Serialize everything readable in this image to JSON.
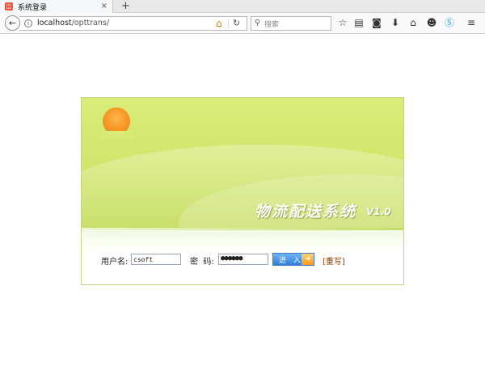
{
  "browser": {
    "tab_title": "系统登录",
    "tab_close": "×",
    "new_tab": "+",
    "url_host": "localhost",
    "url_path": "/opttrans/",
    "search_placeholder": "搜索"
  },
  "icons": {
    "back": "arrow-left-icon",
    "info": "info-icon",
    "home": "home-icon",
    "reload": "reload-icon",
    "search": "search-icon",
    "bookmark": "star-icon",
    "reader": "reader-list-icon",
    "pocket": "pocket-icon",
    "download": "download-icon",
    "home_toolbar": "home-icon",
    "chat": "chat-icon",
    "skype": "skype-icon",
    "menu": "hamburger-menu-icon"
  },
  "login": {
    "system_title": "物流配送系统",
    "version": "V1.0",
    "username_label": "用户名:",
    "username_value": "csoft",
    "password_label": "密  码:",
    "password_value": "●●●●●●",
    "submit_label": "进 入",
    "reset_label": "[重写]"
  },
  "colors": {
    "banner_green": "#d3e76e",
    "sun_orange": "#f5921e",
    "button_blue": "#2f7fd9",
    "reset_brown": "#8b3a00"
  }
}
